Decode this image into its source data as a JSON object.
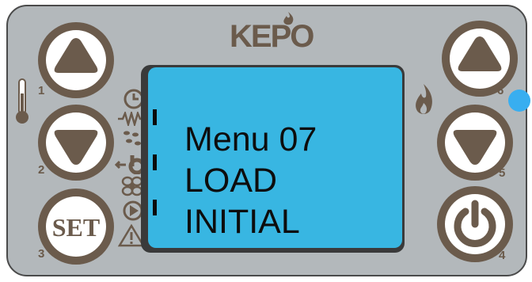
{
  "brand": {
    "logo_text": "KEPO",
    "accent": "#6b5b4c",
    "lcd_color": "#38b6e2",
    "led_color": "#38aef0"
  },
  "display": {
    "lines": [
      "Menu 07",
      "LOAD",
      "INITIAL"
    ]
  },
  "buttons": {
    "b1": {
      "number": "1",
      "icon": "up-arrow-icon"
    },
    "b2": {
      "number": "2",
      "icon": "down-arrow-icon"
    },
    "b3": {
      "number": "3",
      "label": "SET"
    },
    "b4": {
      "number": "4",
      "icon": "power-icon"
    },
    "b5": {
      "number": "5",
      "icon": "down-arrow-icon"
    },
    "b6": {
      "number": "6",
      "icon": "up-arrow-icon"
    }
  },
  "status_icons": [
    "thermometer-icon",
    "clock-icon",
    "heating-element-icon",
    "pellets-icon",
    "auger-icon",
    "fan-icon",
    "pump-icon",
    "warning-icon",
    "flame-icon"
  ]
}
